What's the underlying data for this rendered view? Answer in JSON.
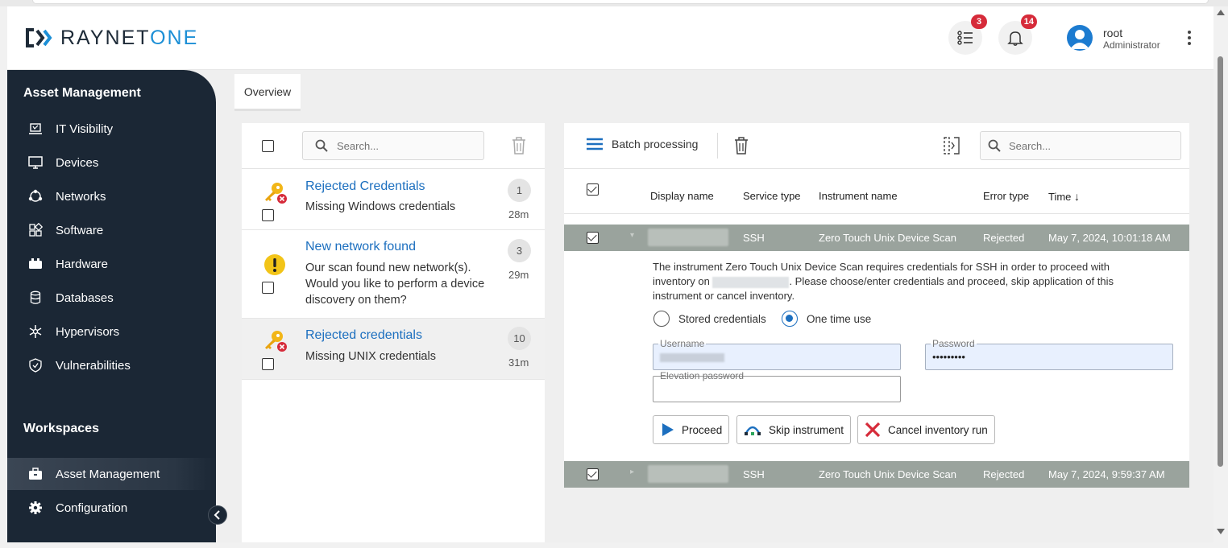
{
  "brand": {
    "name_part1": "RAYNET",
    "name_part2": "ONE",
    "accent_color": "#1c8fd6"
  },
  "header": {
    "tasks_badge": "3",
    "notifications_badge": "14",
    "user_name": "root",
    "user_role": "Administrator"
  },
  "sidebar": {
    "section1_title": "Asset Management",
    "items": [
      {
        "label": "IT Visibility",
        "icon": "laptop-icon"
      },
      {
        "label": "Devices",
        "icon": "monitor-icon"
      },
      {
        "label": "Networks",
        "icon": "network-icon"
      },
      {
        "label": "Software",
        "icon": "software-icon"
      },
      {
        "label": "Hardware",
        "icon": "hardware-icon"
      },
      {
        "label": "Databases",
        "icon": "database-icon"
      },
      {
        "label": "Hypervisors",
        "icon": "hypervisor-icon"
      },
      {
        "label": "Vulnerabilities",
        "icon": "shield-icon"
      }
    ],
    "section2_title": "Workspaces",
    "workspaces": [
      {
        "label": "Asset Management",
        "icon": "briefcase-icon",
        "active": true
      },
      {
        "label": "Configuration",
        "icon": "gear-icon",
        "active": false
      }
    ]
  },
  "tabs": {
    "overview": "Overview"
  },
  "left_panel": {
    "search_placeholder": "Search...",
    "notifications": [
      {
        "title": "Rejected Credentials",
        "body": "Missing Windows credentials",
        "count": "1",
        "age": "28m",
        "icon": "key-error-icon"
      },
      {
        "title": "New network found",
        "body": "Our scan found new network(s). Would you like to perform a device discovery on them?",
        "count": "3",
        "age": "29m",
        "icon": "warning-icon"
      },
      {
        "title": "Rejected credentials",
        "body": "Missing UNIX credentials",
        "count": "10",
        "age": "31m",
        "icon": "key-error-icon"
      }
    ]
  },
  "right_panel": {
    "batch_label": "Batch processing",
    "search_placeholder": "Search...",
    "columns": [
      "Display name",
      "Service type",
      "Instrument name",
      "Error type",
      "Time"
    ],
    "rows": [
      {
        "service": "SSH",
        "instrument": "Zero Touch Unix Device Scan",
        "error": "Rejected",
        "time": "May 7, 2024, 10:01:18 AM"
      },
      {
        "service": "SSH",
        "instrument": "Zero Touch Unix Device Scan",
        "error": "Rejected",
        "time": "May 7, 2024, 9:59:37 AM"
      }
    ],
    "detail": {
      "text_part1": "The instrument Zero Touch Unix Device Scan requires credentials for SSH in order to proceed with inventory on",
      "text_part2": ". Please choose/enter credentials and proceed, skip application of this instrument or cancel inventory.",
      "radio_stored": "Stored credentials",
      "radio_onetime": "One time use",
      "username_label": "Username",
      "password_label": "Password",
      "password_value": "•••••••••",
      "elevation_label": "Elevation password",
      "proceed": "Proceed",
      "skip": "Skip instrument",
      "cancel": "Cancel inventory run"
    }
  }
}
